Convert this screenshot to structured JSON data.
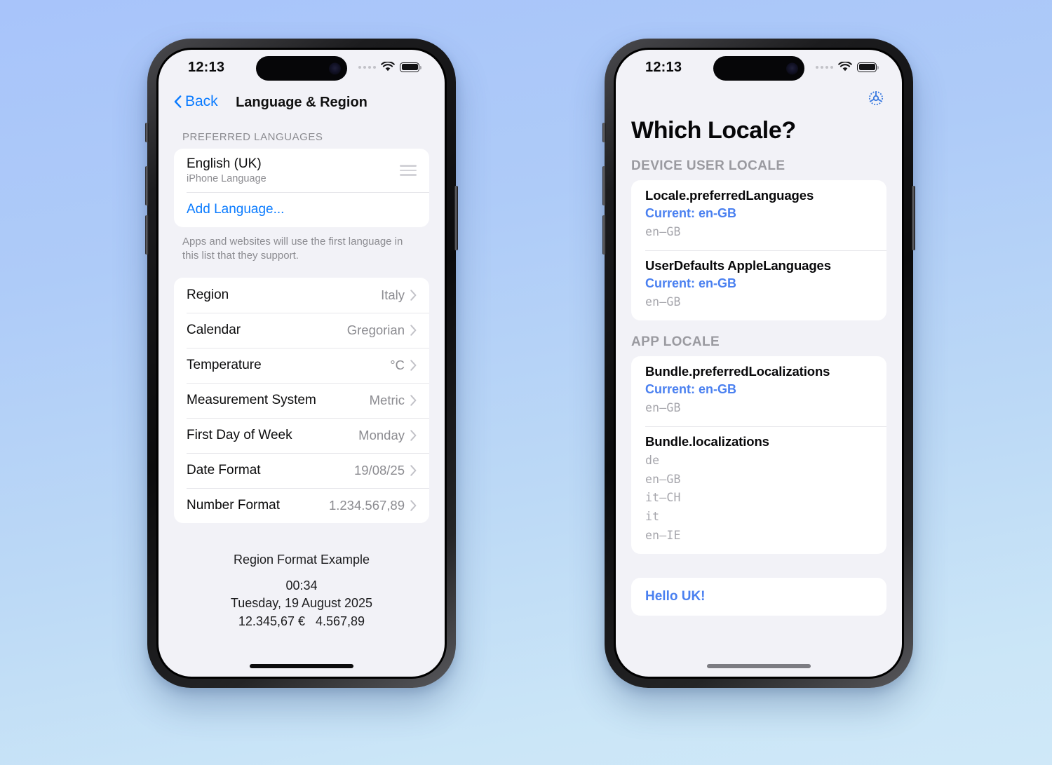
{
  "background": {
    "top_color": "#a8c4fa",
    "bottom_color": "#cbe6f7"
  },
  "accent_color": "#0a7bff",
  "app_accent_color": "#4a80f0",
  "phones": {
    "left": {
      "status_bar": {
        "time": "12:13",
        "cellular_icon": "cellular-dots-icon",
        "wifi_icon": "wifi-icon",
        "battery_icon": "battery-full-icon"
      },
      "navbar": {
        "back_label": "Back",
        "back_icon": "chevron-left-icon",
        "title": "Language & Region"
      },
      "preferred_languages": {
        "header": "PREFERRED LANGUAGES",
        "language": {
          "name": "English (UK)",
          "subtitle": "iPhone Language",
          "reorder_icon": "reorder-handle-icon"
        },
        "add_language_label": "Add Language...",
        "footnote": "Apps and websites will use the first language in this list that they support."
      },
      "region_settings": [
        {
          "label": "Region",
          "value": "Italy"
        },
        {
          "label": "Calendar",
          "value": "Gregorian"
        },
        {
          "label": "Temperature",
          "value": "°C"
        },
        {
          "label": "Measurement System",
          "value": "Metric"
        },
        {
          "label": "First Day of Week",
          "value": "Monday"
        },
        {
          "label": "Date Format",
          "value": "19/08/25"
        },
        {
          "label": "Number Format",
          "value": "1.234.567,89"
        }
      ],
      "region_example": {
        "title": "Region Format Example",
        "lines": [
          "00:34",
          "Tuesday, 19 August 2025",
          "12.345,67 €   4.567,89"
        ]
      },
      "home_indicator": "home-indicator"
    },
    "right": {
      "status_bar": {
        "time": "12:13",
        "cellular_icon": "cellular-dots-icon",
        "wifi_icon": "wifi-icon",
        "battery_icon": "battery-full-icon"
      },
      "toolbar": {
        "settings_icon": "gear-icon"
      },
      "title": "Which Locale?",
      "sections": [
        {
          "header": "DEVICE USER LOCALE",
          "rows": [
            {
              "title": "Locale.preferredLanguages",
              "current": "Current: en-GB",
              "values": [
                "en–GB"
              ]
            },
            {
              "title": "UserDefaults AppleLanguages",
              "current": "Current: en-GB",
              "values": [
                "en–GB"
              ]
            }
          ]
        },
        {
          "header": "APP LOCALE",
          "rows": [
            {
              "title": "Bundle.preferredLocalizations",
              "current": "Current: en-GB",
              "values": [
                "en–GB"
              ]
            },
            {
              "title": "Bundle.localizations",
              "current": "",
              "values": [
                "de",
                "en–GB",
                "it–CH",
                "it",
                "en–IE"
              ]
            }
          ]
        }
      ],
      "hello_label": "Hello UK!",
      "home_indicator": "home-indicator"
    }
  }
}
